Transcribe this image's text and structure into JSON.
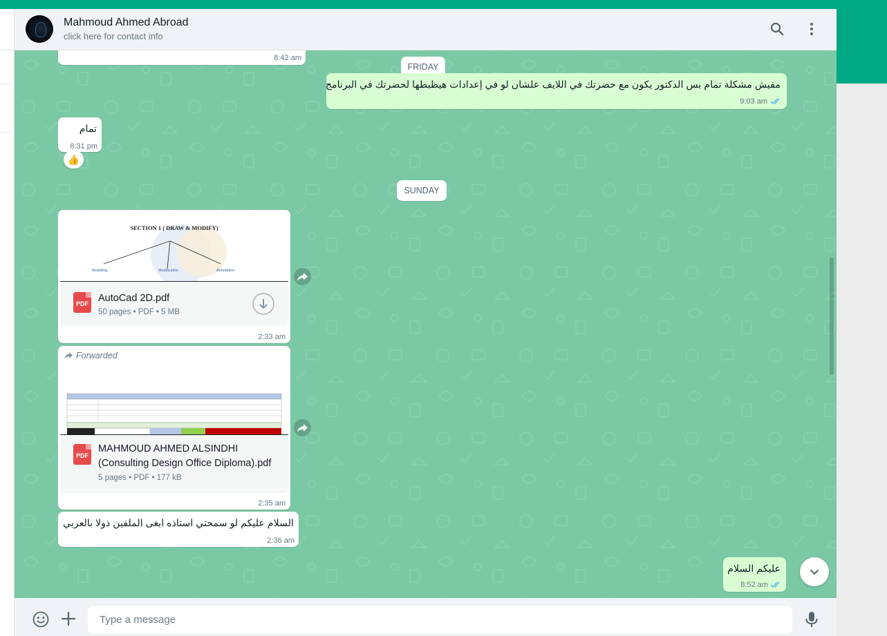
{
  "header": {
    "contact_name": "Mahmoud Ahmed Abroad",
    "contact_sub": "click here for contact info"
  },
  "dates": {
    "friday": "FRIDAY",
    "sunday": "SUNDAY"
  },
  "messages": {
    "m0_time": "8:42 am",
    "m1_text": "مفيش مشكلة تمام بس الدكتور يكون مع حضرتك في اللايف علشان لو في إعدادات هيظبطها لحضرتك في البرنامج",
    "m1_time": "9:03 am",
    "m2_text": "تمام",
    "m2_time": "8:31 pm",
    "m2_reaction": "👍",
    "m3_preview_title": "SECTION 1 ( DRAW & MODIFY)",
    "m3_preview_labels": [
      "Modeling",
      "Modification",
      "Annotation"
    ],
    "m3_doc_name": "AutoCad 2D.pdf",
    "m3_doc_meta": "50 pages • PDF • 5 MB",
    "m3_time": "2:33 am",
    "m4_forwarded": "Forwarded",
    "m4_doc_name_1": "MAHMOUD AHMED ALSINDHI",
    "m4_doc_name_2": "(Consulting Design Office Diploma).pdf",
    "m4_doc_meta": "5 pages • PDF • 177 kB",
    "m4_time": "2:35 am",
    "m5_text": "السلام عليكم لو سمحتي استاذه ابغى الملفين ذولا بالعربي",
    "m5_time": "2:36 am",
    "m6_text": "عليكم السلام",
    "m6_time": "8:52 am"
  },
  "pdf_label": "PDF",
  "composer": {
    "placeholder": "Type a message"
  },
  "icons": {
    "search": "search-icon",
    "menu": "kebab-menu-icon",
    "emoji": "emoji-icon",
    "attach": "plus-icon",
    "mic": "microphone-icon",
    "forward": "forward-arrow-icon",
    "download": "download-icon",
    "check": "double-check-icon",
    "scroll": "chevron-down-icon"
  },
  "colors": {
    "accent": "#00a884",
    "chat_bg": "#7bc8a4",
    "outgoing": "#d9fdd3",
    "incoming": "#ffffff",
    "pdf_red": "#e64a4a",
    "read_tick": "#53bdeb"
  }
}
